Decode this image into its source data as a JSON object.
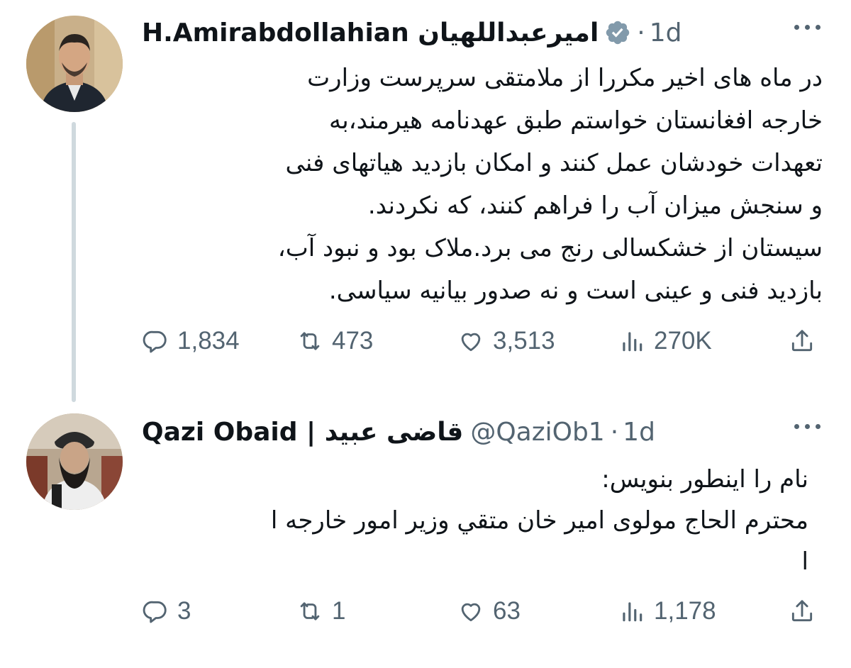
{
  "tweets": [
    {
      "display_name": "H.Amirabdollahian امیرعبداللهیان",
      "verified": true,
      "handle": "",
      "separator": "·",
      "time": "1d",
      "lines": [
        "در ماه های اخیر مکررا از ملامتقی سرپرست وزارت",
        "خارجه افغانستان خواستم طبق عهدنامه هیرمند،به",
        "تعهدات خودشان عمل کنند و امکان بازدید هیاتهای فنی",
        "و سنجش میزان آب را فراهم کنند، که نکردند.",
        "سیستان از خشکسالی رنج می برد.ملاک بود و نبود آب،",
        "بازدید فنی و عینی است و نه صدور بیانیه سیاسی."
      ],
      "stats": {
        "replies": "1,834",
        "retweets": "473",
        "likes": "3,513",
        "views": "270K"
      }
    },
    {
      "display_name": "Qazi Obaid | قاضی عبید",
      "verified": false,
      "handle": "@QaziOb1",
      "separator": "·",
      "time": "1d",
      "lines": [
        "نام را اینطور بنویس:",
        "محترم الحاج مولوی امیر خان متقي وزیر امور خارجه ا",
        "ا"
      ],
      "stats": {
        "replies": "3",
        "retweets": "1",
        "likes": "63",
        "views": "1,178"
      }
    }
  ],
  "icons": {
    "reply": "reply-icon",
    "retweet": "retweet-icon",
    "like": "heart-icon",
    "views": "views-icon",
    "share": "share-icon",
    "more": "more-dots-icon",
    "verified": "verified-badge-icon"
  },
  "colors": {
    "text": "#0f1419",
    "secondary": "#536471",
    "thread": "#cfd9de",
    "verified": "#829aab"
  }
}
